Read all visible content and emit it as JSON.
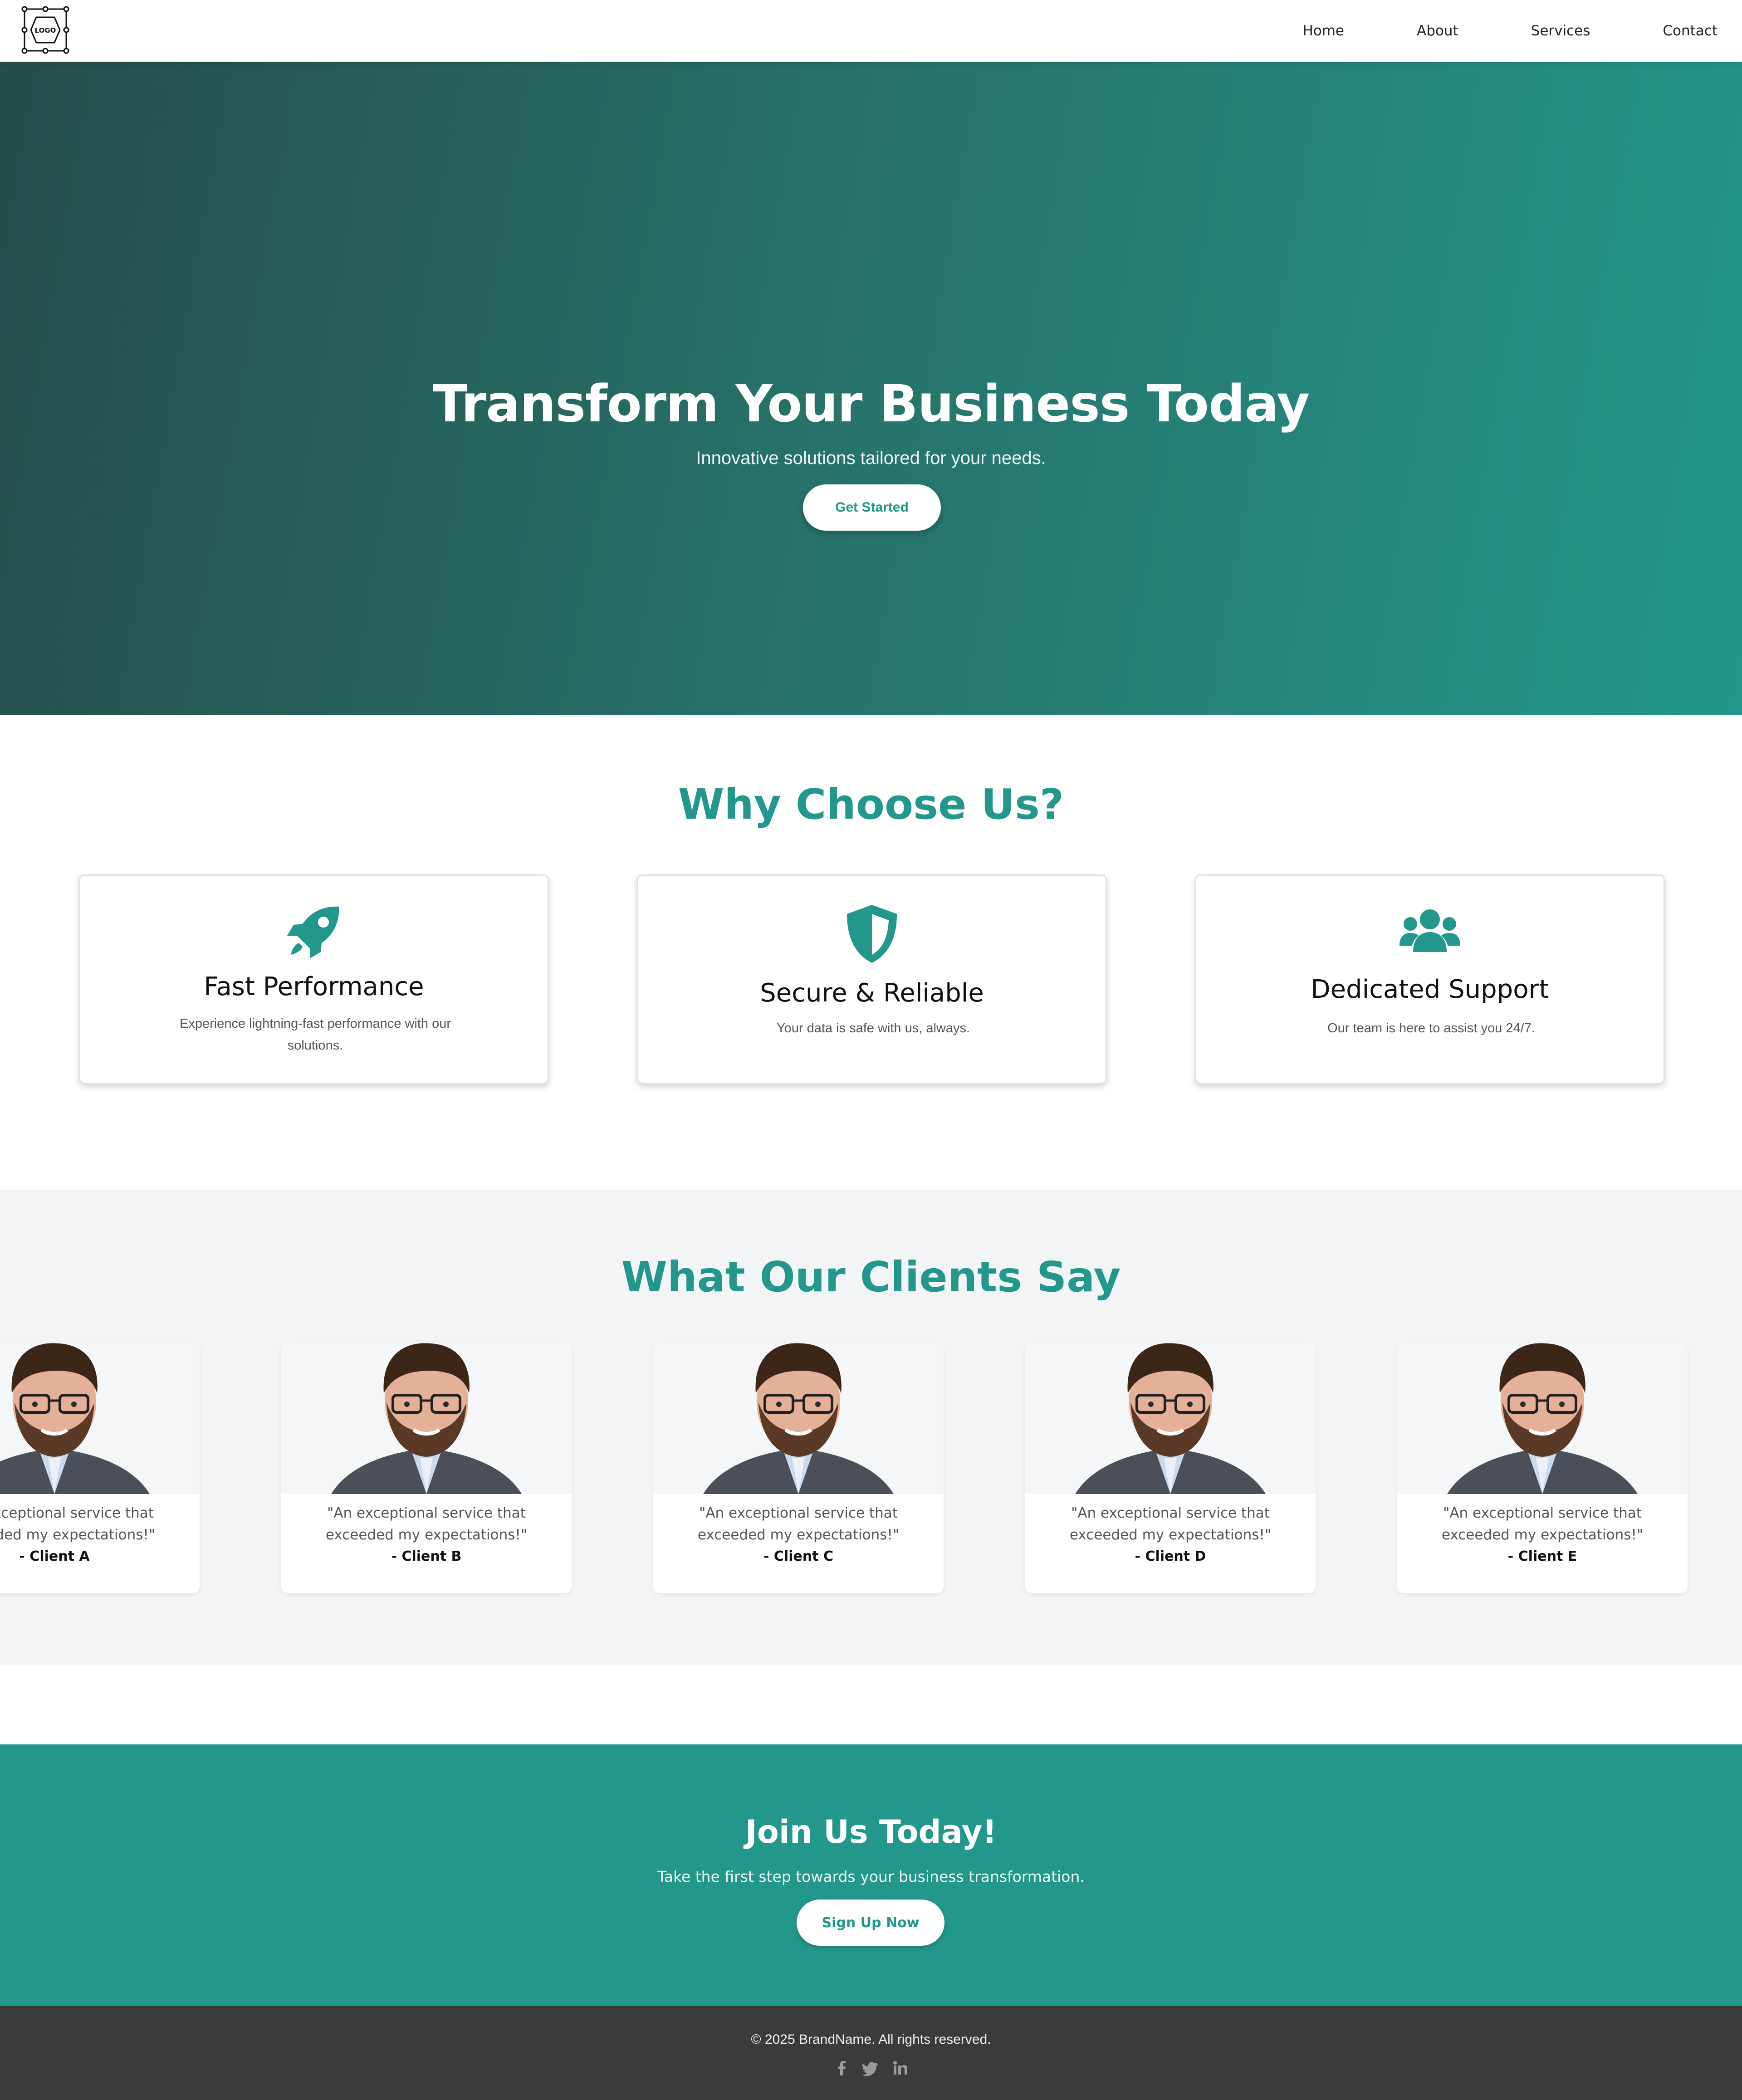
{
  "nav": {
    "logo_label": "LOGO",
    "links": [
      "Home",
      "About",
      "Services",
      "Contact"
    ]
  },
  "hero": {
    "title": "Transform Your Business Today",
    "subtitle": "Innovative solutions tailored for your needs.",
    "cta_label": "Get Started",
    "gradient": [
      "#254d4a",
      "#23978b"
    ]
  },
  "why": {
    "title": "Why Choose Us?",
    "features": [
      {
        "icon": "rocket-icon",
        "title": "Fast Performance",
        "text": "Experience lightning-fast performance with our solutions."
      },
      {
        "icon": "shield-icon",
        "title": "Secure & Reliable",
        "text": "Your data is safe with us, always."
      },
      {
        "icon": "users-icon",
        "title": "Dedicated Support",
        "text": "Our team is here to assist you 24/7."
      }
    ]
  },
  "testimonials": {
    "title": "What Our Clients Say",
    "items": [
      {
        "quote": "\"An exceptional service that exceeded my expectations!\"",
        "client": "- Client A"
      },
      {
        "quote": "\"An exceptional service that exceeded my expectations!\"",
        "client": "- Client B"
      },
      {
        "quote": "\"An exceptional service that exceeded my expectations!\"",
        "client": "- Client C"
      },
      {
        "quote": "\"An exceptional service that exceeded my expectations!\"",
        "client": "- Client D"
      },
      {
        "quote": "\"An exceptional service that exceeded my expectations!\"",
        "client": "- Client E"
      }
    ]
  },
  "cta": {
    "title": "Join Us Today!",
    "subtitle": "Take the first step towards your business transformation.",
    "button_label": "Sign Up Now"
  },
  "footer": {
    "copyright": "© 2025 BrandName. All rights reserved.",
    "social": [
      "facebook-icon",
      "twitter-icon",
      "linkedin-icon"
    ]
  },
  "colors": {
    "accent": "#23978b",
    "footer_bg": "#3b3b3b",
    "testimonials_bg": "#f3f4f6"
  }
}
